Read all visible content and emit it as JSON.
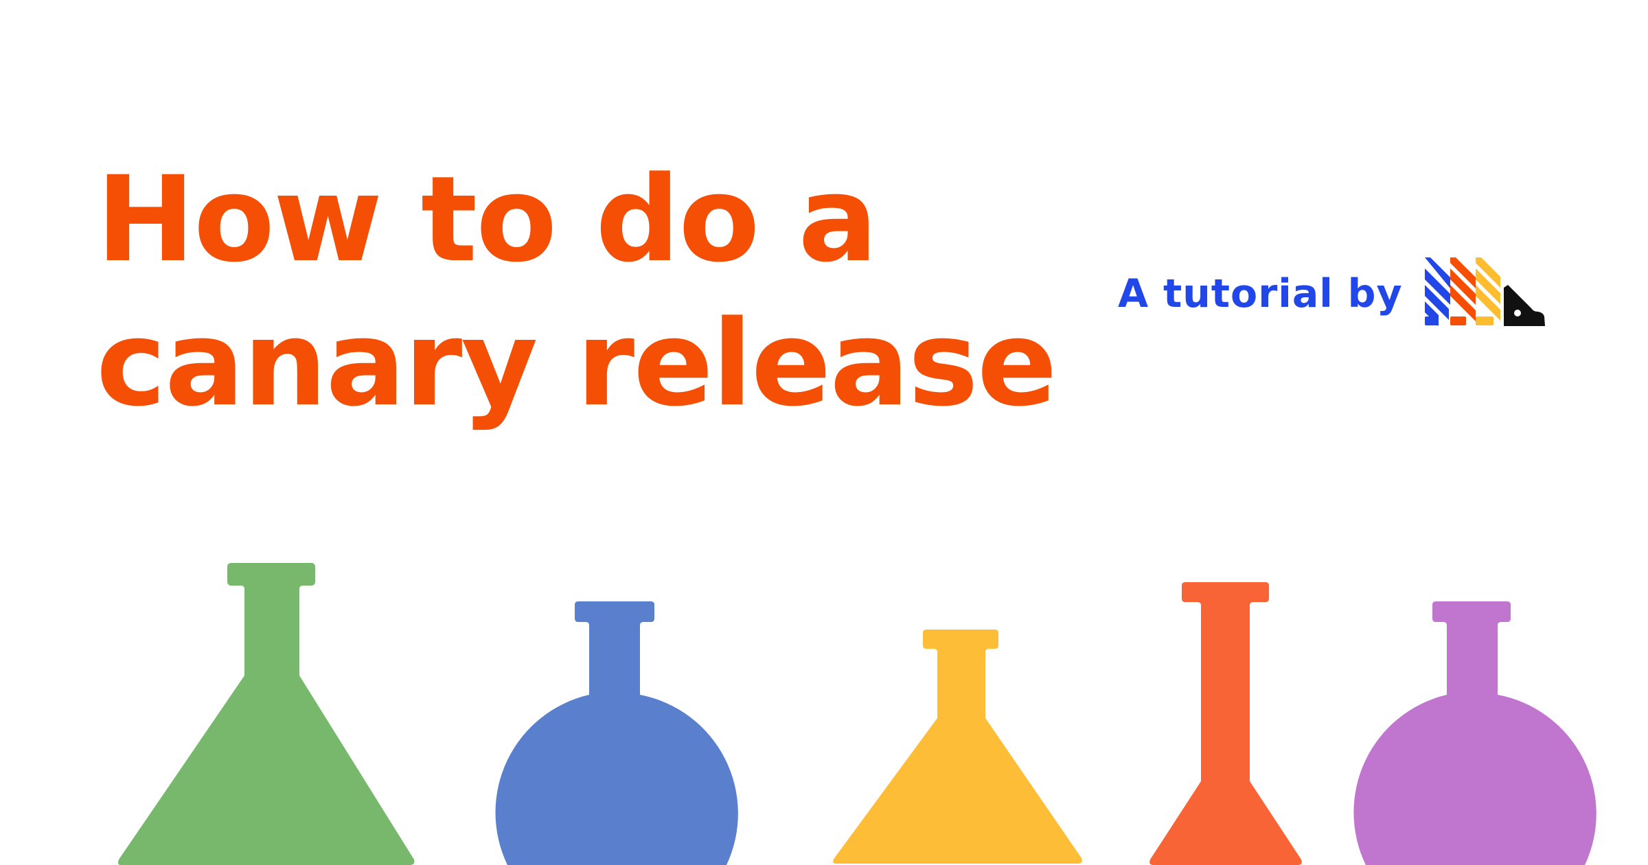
{
  "hero": {
    "title_line_1": "How to do a",
    "title_line_2": "canary release",
    "title_color": "#F54E05"
  },
  "byline": {
    "text": "A tutorial by",
    "color": "#2247E8"
  },
  "logo": {
    "icon": "stacked-stripes-logo",
    "colors": [
      "#2247E8",
      "#F54E05",
      "#FEBD2E",
      "#111111"
    ]
  },
  "flasks": [
    {
      "name": "erlenmeyer-flask",
      "color": "#78B86C"
    },
    {
      "name": "round-bottom-flask",
      "color": "#5A7FCC"
    },
    {
      "name": "erlenmeyer-flask",
      "color": "#FEBD37"
    },
    {
      "name": "erlenmeyer-flask",
      "color": "#F96436"
    },
    {
      "name": "round-bottom-flask",
      "color": "#C075CE"
    }
  ]
}
